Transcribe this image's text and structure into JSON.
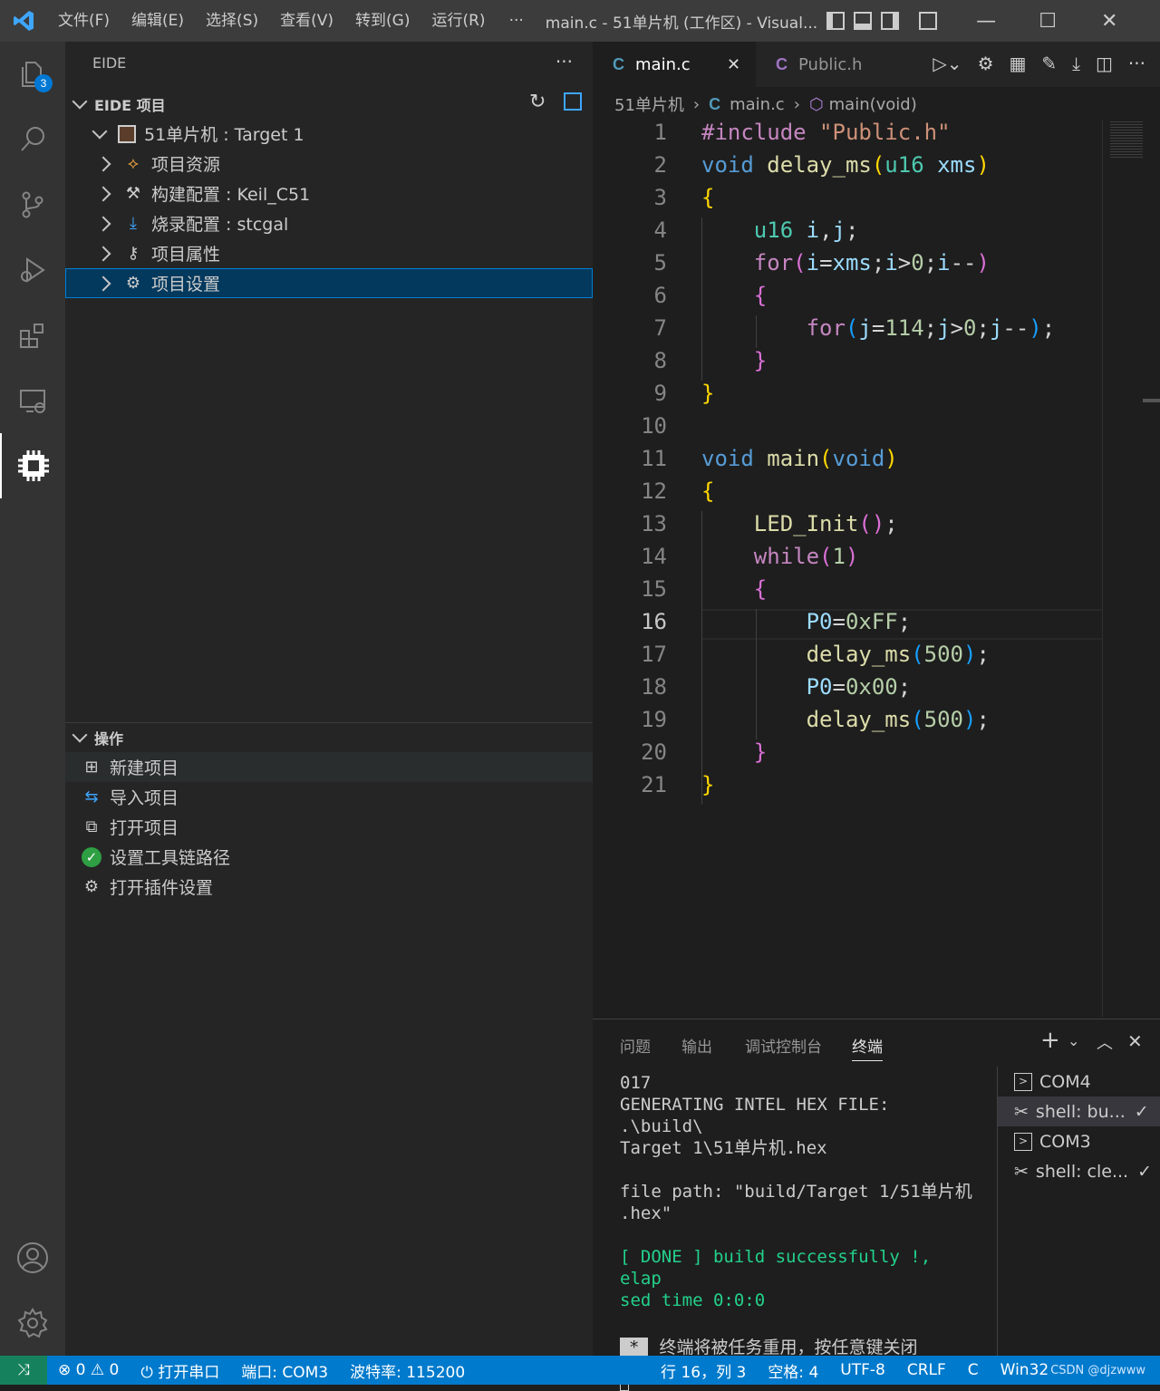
{
  "titlebar": {
    "menus": [
      "文件(F)",
      "编辑(E)",
      "选择(S)",
      "查看(V)",
      "转到(G)",
      "运行(R)"
    ],
    "more": "···",
    "window_title": "main.c - 51单片机 (工作区) - Visual..."
  },
  "activity": {
    "explorer_badge": "3"
  },
  "sidebar": {
    "title": "EIDE",
    "more": "···",
    "project_section": "EIDE 项目",
    "project_name": "51单片机 : Target 1",
    "items": [
      "项目资源",
      "构建配置 : Keil_C51",
      "烧录配置 : stcgal",
      "项目属性",
      "项目设置"
    ],
    "ops_section": "操作",
    "ops": [
      "新建项目",
      "导入项目",
      "打开项目",
      "设置工具链路径",
      "打开插件设置"
    ]
  },
  "tabs": [
    {
      "lang": "C",
      "label": "main.c",
      "close": "✕"
    },
    {
      "lang": "C",
      "label": "Public.h"
    }
  ],
  "breadcrumb": {
    "folder": "51单片机",
    "lang": "C",
    "file": "main.c",
    "symbol": "main(void)"
  },
  "code": {
    "line_numbers": [
      "1",
      "2",
      "3",
      "4",
      "5",
      "6",
      "7",
      "8",
      "9",
      "10",
      "11",
      "12",
      "13",
      "14",
      "15",
      "16",
      "17",
      "18",
      "19",
      "20",
      "21"
    ],
    "current_line": "16"
  },
  "panel": {
    "tabs": [
      "问题",
      "输出",
      "调试控制台",
      "终端"
    ],
    "terminal_lines": [
      "017",
      "GENERATING INTEL HEX FILE: .\\build\\",
      "Target 1\\51单片机.hex",
      "",
      "file path: \"build/Target 1/51单片机",
      ".hex\"",
      "",
      "[ DONE ] build successfully !, elap",
      "sed time 0:0:0",
      "",
      "终端将被任务重用，按任意键关闭",
      "。"
    ],
    "star": "*",
    "terminals": [
      "COM4",
      "shell: bu...",
      "COM3",
      "shell: cle..."
    ]
  },
  "statusbar": {
    "errors": "0",
    "warnings": "0",
    "open_serial": "打开串口",
    "port": "端口: COM3",
    "baud": "波特率: 115200",
    "position": "行 16，列 3",
    "spaces": "空格: 4",
    "encoding": "UTF-8",
    "eol": "CRLF",
    "language": "C",
    "platform": "Win32",
    "watermark": "CSDN @djzwww"
  }
}
